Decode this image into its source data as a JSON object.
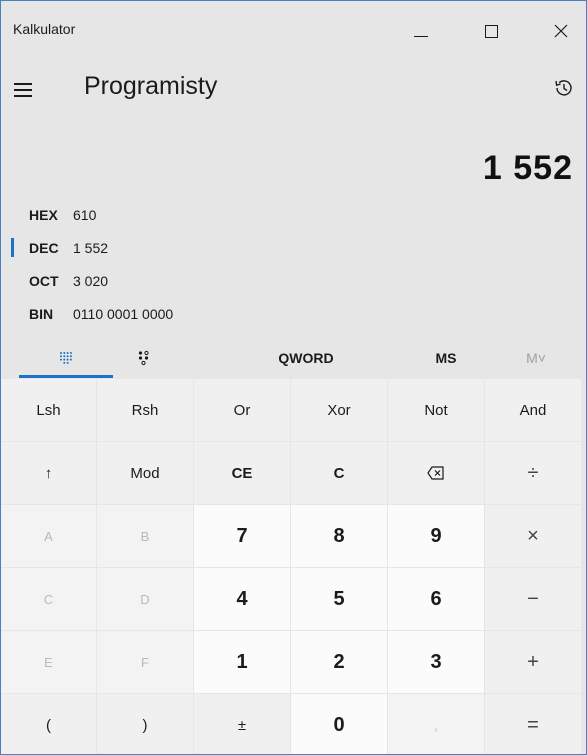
{
  "window": {
    "title": "Kalkulator",
    "minimize_icon": "minimize-icon",
    "maximize_icon": "maximize-icon",
    "close_icon": "close-icon"
  },
  "header": {
    "mode": "Programisty",
    "menu_icon": "hamburger-icon",
    "history_icon": "history-icon"
  },
  "display": {
    "value": "1 552"
  },
  "radix": [
    {
      "label": "HEX",
      "value": "610",
      "selected": false
    },
    {
      "label": "DEC",
      "value": "1 552",
      "selected": true
    },
    {
      "label": "OCT",
      "value": "3 020",
      "selected": false
    },
    {
      "label": "BIN",
      "value": "0110 0001 0000",
      "selected": false
    }
  ],
  "tabs": {
    "keypad_icon": "full-keypad-icon",
    "bits_icon": "bit-toggle-icon",
    "word_size": "QWORD",
    "memory_store": "MS",
    "memory_view": "M˅"
  },
  "keys": [
    [
      "Lsh",
      "Rsh",
      "Or",
      "Xor",
      "Not",
      "And"
    ],
    [
      "↑",
      "Mod",
      "CE",
      "C",
      "⌫",
      "÷"
    ],
    [
      "A",
      "B",
      "7",
      "8",
      "9",
      "×"
    ],
    [
      "C",
      "D",
      "4",
      "5",
      "6",
      "−"
    ],
    [
      "E",
      "F",
      "1",
      "2",
      "3",
      "+"
    ],
    [
      "(",
      ")",
      "±",
      "0",
      ",",
      "="
    ]
  ],
  "colors": {
    "accent": "#1a73c9",
    "background": "#e6e6e6"
  }
}
